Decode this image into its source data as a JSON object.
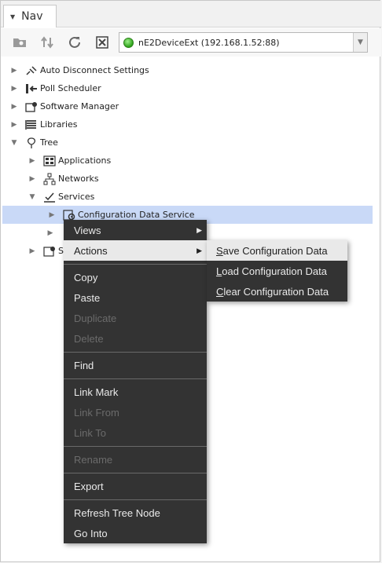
{
  "window": {
    "tab_title": "Nav"
  },
  "toolbar": {
    "device": "nE2DeviceExt (192.168.1.52:88)",
    "buttons": [
      "open-folder-icon",
      "sync-arrows-icon",
      "refresh-icon",
      "close-box-icon"
    ]
  },
  "tree": {
    "items": [
      {
        "label": "Auto Disconnect Settings",
        "icon": "plug-disconnect-icon"
      },
      {
        "label": "Poll Scheduler",
        "icon": "poll-scheduler-icon"
      },
      {
        "label": "Software Manager",
        "icon": "software-manager-icon"
      },
      {
        "label": "Libraries",
        "icon": "libraries-icon"
      },
      {
        "label": "Tree",
        "icon": "tree-icon"
      },
      {
        "label": "Applications",
        "icon": "applications-icon"
      },
      {
        "label": "Networks",
        "icon": "networks-icon"
      },
      {
        "label": "Services",
        "icon": "services-icon"
      },
      {
        "label": "Configuration Data Service",
        "icon": "config-data-icon"
      },
      {
        "label": "S",
        "icon": "system-icon"
      }
    ]
  },
  "context_menu": {
    "views": "Views",
    "actions": "Actions",
    "copy": "Copy",
    "paste": "Paste",
    "duplicate": "Duplicate",
    "delete": "Delete",
    "find": "Find",
    "link_mark": "Link Mark",
    "link_from": "Link From",
    "link_to": "Link To",
    "rename": "Rename",
    "export": "Export",
    "refresh_tree_node": "Refresh Tree Node",
    "go_into": "Go Into"
  },
  "actions_submenu": {
    "save": {
      "mnemonic": "S",
      "rest": "ave Configuration Data"
    },
    "load": {
      "mnemonic": "L",
      "rest": "oad Configuration Data"
    },
    "clear": {
      "mnemonic": "C",
      "rest": "lear Configuration Data"
    }
  }
}
